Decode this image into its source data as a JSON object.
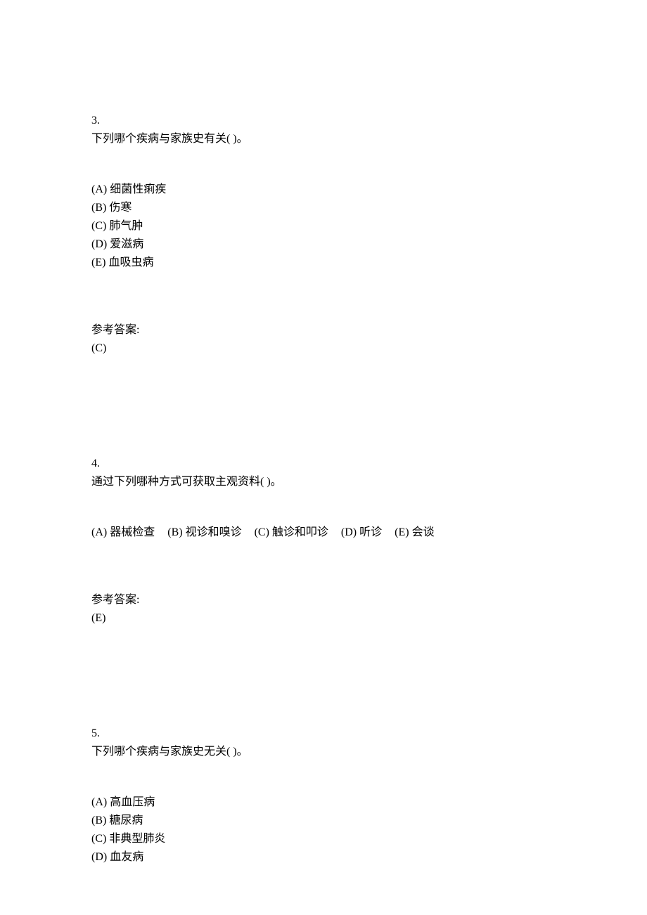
{
  "questions": [
    {
      "number": "3.",
      "text": "下列哪个疾病与家族史有关( )。",
      "layout": "vertical",
      "options": [
        {
          "label": "(A)",
          "text": "细菌性痢疾"
        },
        {
          "label": "(B)",
          "text": "伤寒"
        },
        {
          "label": "(C)",
          "text": "肺气肿"
        },
        {
          "label": "(D)",
          "text": "爱滋病"
        },
        {
          "label": "(E)",
          "text": "血吸虫病"
        }
      ],
      "answer_label": "参考答案:",
      "answer_value": "(C)"
    },
    {
      "number": "4.",
      "text": "通过下列哪种方式可获取主观资料( )。",
      "layout": "horizontal",
      "options": [
        {
          "label": "(A)",
          "text": "器械检查"
        },
        {
          "label": "(B)",
          "text": "视诊和嗅诊"
        },
        {
          "label": "(C)",
          "text": "触诊和叩诊"
        },
        {
          "label": "(D)",
          "text": "听诊"
        },
        {
          "label": "(E)",
          "text": "会谈"
        }
      ],
      "answer_label": "参考答案:",
      "answer_value": "(E)"
    },
    {
      "number": "5.",
      "text": "下列哪个疾病与家族史无关( )。",
      "layout": "vertical",
      "options": [
        {
          "label": "(A)",
          "text": "高血压病"
        },
        {
          "label": "(B)",
          "text": "糖尿病"
        },
        {
          "label": "(C)",
          "text": "非典型肺炎"
        },
        {
          "label": "(D)",
          "text": "血友病"
        }
      ],
      "answer_label": "",
      "answer_value": ""
    }
  ]
}
